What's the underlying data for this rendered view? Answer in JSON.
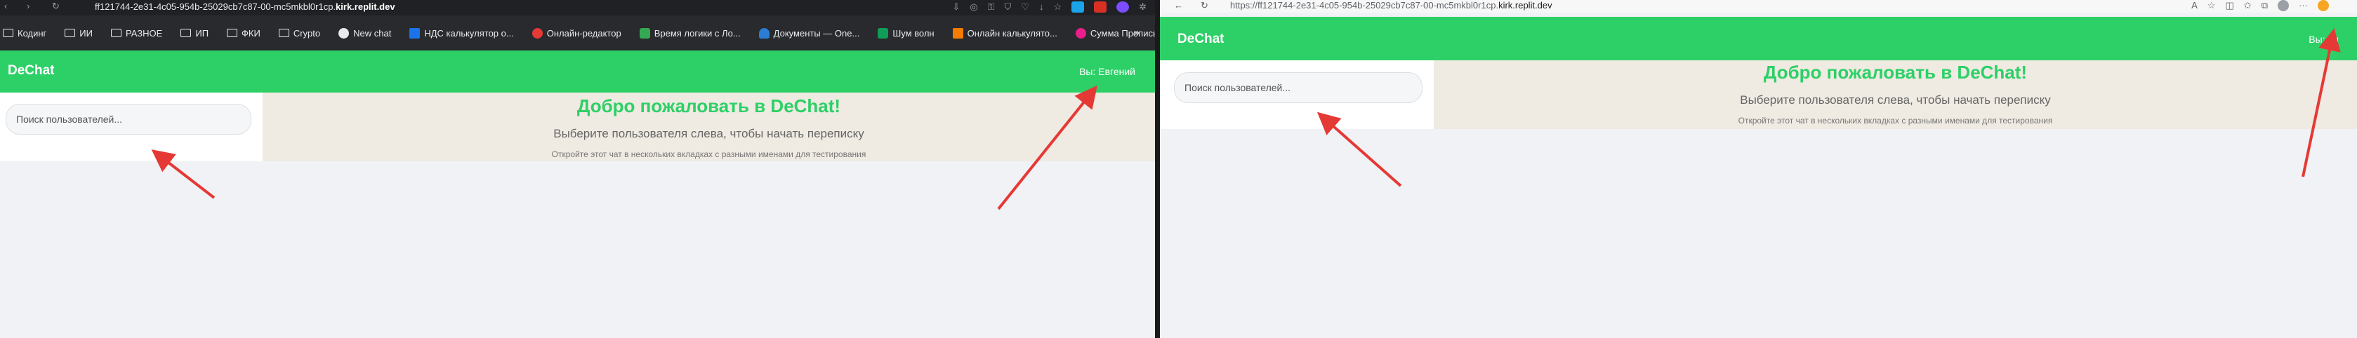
{
  "left_window": {
    "browser": {
      "nav_icons": [
        "back-icon",
        "forward-icon",
        "reload-icon"
      ],
      "url_prefix": "ff121744-2e31-4c05-954b-25029cb7c87-00-mc5mkbl0r1cp.",
      "url_host": "kirk.replit.dev",
      "bookmarks": [
        {
          "label": "Кодинг",
          "icon": "folder-icon"
        },
        {
          "label": "ИИ",
          "icon": "folder-icon"
        },
        {
          "label": "РАЗНОЕ",
          "icon": "folder-icon"
        },
        {
          "label": "ИП",
          "icon": "folder-icon"
        },
        {
          "label": "ФКИ",
          "icon": "folder-icon"
        },
        {
          "label": "Crypto",
          "icon": "folder-icon"
        },
        {
          "label": "New chat",
          "icon": "openai-icon"
        },
        {
          "label": "НДС калькулятор о...",
          "icon": "calculator-icon"
        },
        {
          "label": "Онлайн-редактор",
          "icon": "editor-icon"
        },
        {
          "label": "Время логики с Ло...",
          "icon": "logic-icon"
        },
        {
          "label": "Документы — One...",
          "icon": "cloud-icon"
        },
        {
          "label": "Шум волн",
          "icon": "waves-icon"
        },
        {
          "label": "Онлайн калькулято...",
          "icon": "calculator-icon"
        },
        {
          "label": "Сумма Прописью...",
          "icon": "sum-icon"
        }
      ],
      "more_label": "»"
    },
    "app": {
      "brand": "DeChat",
      "user_label": "Вы: Евгений",
      "search_placeholder": "Поиск пользователей...",
      "welcome_title": "Добро пожаловать в DeChat!",
      "welcome_subtitle": "Выберите пользователя слева, чтобы начать переписку",
      "welcome_hint": "Откройте этот чат в нескольких вкладках с разными именами для тестирования"
    }
  },
  "right_window": {
    "browser": {
      "url_prefix": "https://ff121744-2e31-4c05-954b-25029cb7c87-00-mc5mkbl0r1cp.",
      "url_host": "kirk.replit.dev"
    },
    "app": {
      "brand": "DeChat",
      "user_label": "Вы: ен",
      "search_placeholder": "Поиск пользователей...",
      "welcome_title": "Добро пожаловать в DeChat!",
      "welcome_subtitle": "Выберите пользователя слева, чтобы начать переписку",
      "welcome_hint": "Откройте этот чат в нескольких вкладках с разными именами для тестирования"
    }
  },
  "colors": {
    "accent": "#2dd067",
    "arrow": "#e53935",
    "welcome_bg": "#efeae2",
    "page_bg": "#f0f2f5"
  }
}
